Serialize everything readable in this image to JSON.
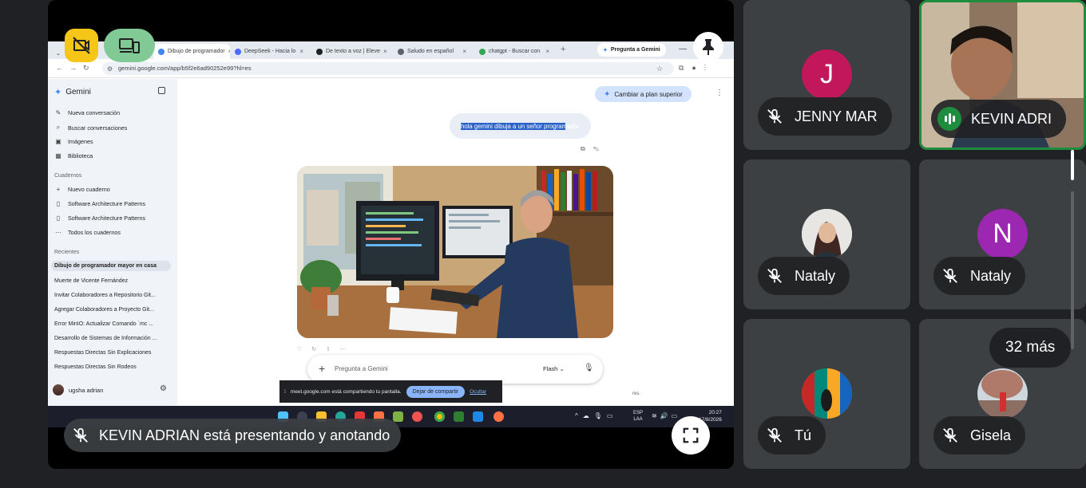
{
  "browser": {
    "tabs": [
      {
        "label": "Dibujo de programador",
        "active": true,
        "color": "#4285f4"
      },
      {
        "label": "DeepSeek - Hacia lo",
        "color": "#4d6bfe"
      },
      {
        "label": "De texto a voz | Eleve",
        "color": "#202124"
      },
      {
        "label": "Saludo en español",
        "color": "#5f6368"
      },
      {
        "label": "chatgpt - Buscar con",
        "color": "#34a853"
      }
    ],
    "gemini_tab": "Pregunta a Gemini",
    "url": "gemini.google.com/app/b5f2e6ad90252e99?hl=es"
  },
  "sidebar": {
    "brand": "Gemini",
    "items": [
      {
        "label": "Nueva conversación",
        "icon": "✎"
      },
      {
        "label": "Buscar conversaciones",
        "icon": "⌕"
      },
      {
        "label": "Imágenes",
        "icon": "▣"
      },
      {
        "label": "Biblioteca",
        "icon": "▦"
      }
    ],
    "notebooks_title": "Cuadernos",
    "notebooks": [
      {
        "label": "Nuevo cuaderno",
        "icon": "+"
      },
      {
        "label": "Software Architecture Patterns",
        "icon": "▯"
      },
      {
        "label": "Software Architecture Patterns",
        "icon": "▯"
      },
      {
        "label": "Todos los cuadernos",
        "icon": "⋯"
      }
    ],
    "recents_title": "Recientes",
    "recents": [
      "Dibujo de programador mayor en casa",
      "Muerte de Vicente Fernández",
      "Invitar Colaboradores a Repositorio Git...",
      "Agregar Colaboradores a Proyecto Git...",
      "Error MinIO: Actualizar Comando `mc ...",
      "Desarrollo de Sistemas de Información ...",
      "Respuestas Directas Sin Explicaciones",
      "Respuestas Directas Sin Rodeos"
    ],
    "user": "ugsha adrian"
  },
  "main": {
    "upgrade": "Cambiar a plan superior",
    "prompt": "hola gemini dibuja a un señor programador",
    "input_placeholder": "Pregunta a Gemini",
    "model": "Flash",
    "disclaimer": "res."
  },
  "share_notice": {
    "text": "meet.google.com está compartiendo tu pantalla.",
    "stop": "Dejar de compartir",
    "hide": "Ocultar"
  },
  "taskbar": {
    "lang_top": "ESP",
    "lang_bottom": "LAA",
    "time": "20:27",
    "date": "17/8/2026"
  },
  "meet": {
    "presenting": "KEVIN ADRIAN está presentando y anotando",
    "participants": [
      {
        "name": "JENNY MAR",
        "initial": "J",
        "color": "#c2185b"
      },
      {
        "name": "KEVIN ADRI",
        "speaking": true
      },
      {
        "name": "Nataly",
        "photo": true
      },
      {
        "name": "Nataly",
        "initial": "N",
        "color": "#9c27b0"
      },
      {
        "name": "Tú",
        "photo": true
      },
      {
        "name": "Gisela",
        "photo": true
      }
    ],
    "more": "32 más"
  }
}
